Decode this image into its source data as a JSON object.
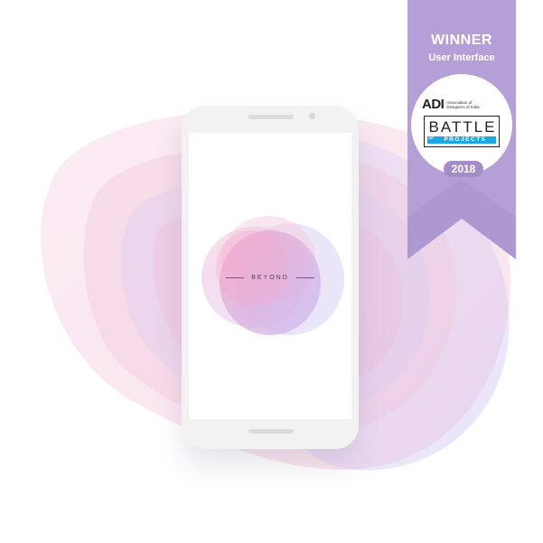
{
  "app": {
    "brand_name": "BEYOND"
  },
  "award": {
    "title": "WINNER",
    "category": "User Interface",
    "organizer_abbr": "ADI",
    "organizer_line1": "Association of",
    "organizer_line2": "Designers of India",
    "event_name": "BATTLE",
    "event_of": "OF",
    "event_sub": "PROJECTS",
    "year": "2018"
  },
  "colors": {
    "ribbon": "#b49fd6",
    "ribbon_fold": "#a891cb",
    "year_pill": "#a48cc6",
    "battle_bar": "#1ba9e3",
    "blob_pink": "#f4cde0",
    "blob_lavender": "#d8ccf2",
    "brand_text": "#4e3f63"
  },
  "icons": {
    "device": "smartphone-icon",
    "award": "award-ribbon-icon"
  }
}
